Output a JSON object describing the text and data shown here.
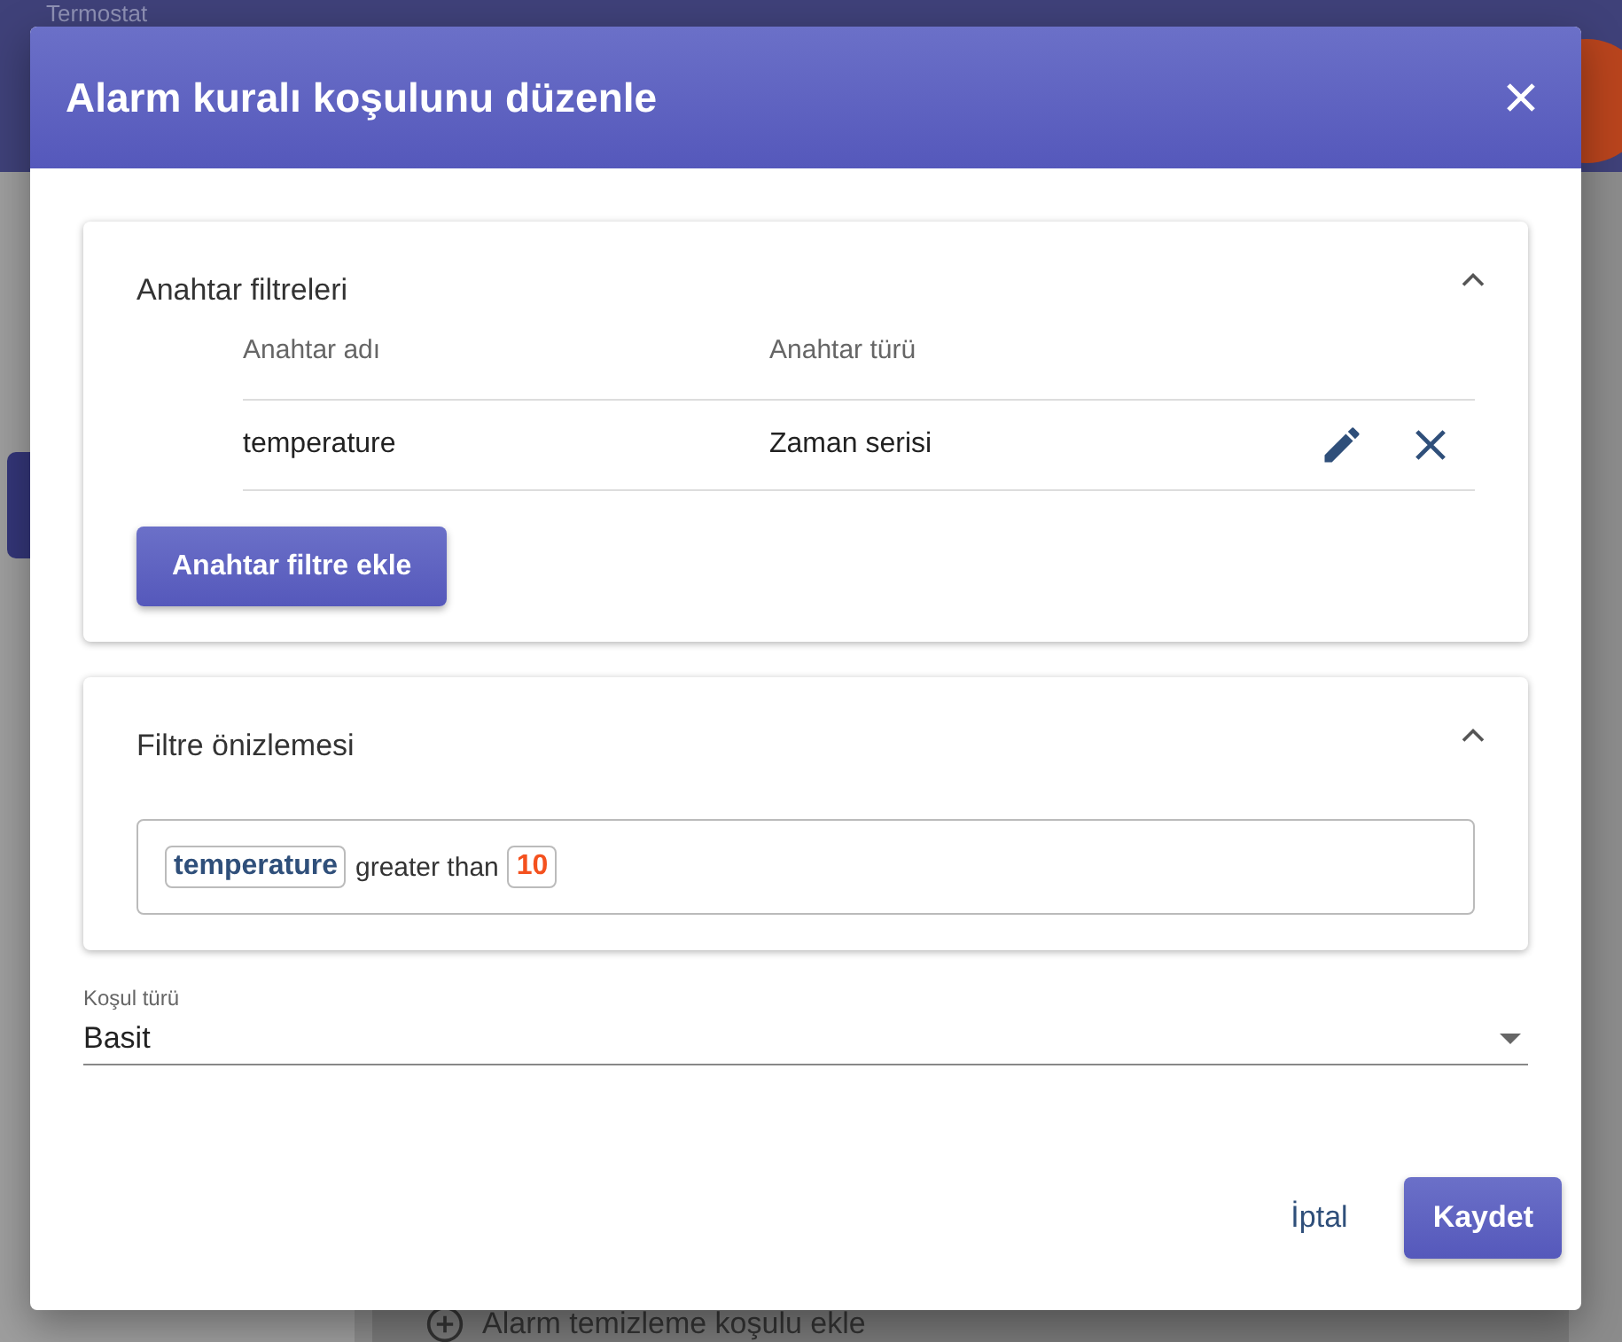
{
  "background": {
    "title": "Termostat",
    "bottom_button": "Alarm temizleme koşulu ekle"
  },
  "dialog": {
    "title": "Alarm kuralı koşulunu düzenle",
    "key_filters": {
      "title": "Anahtar filtreleri",
      "expanded": true,
      "columns": [
        "Anahtar adı",
        "Anahtar türü"
      ],
      "rows": [
        {
          "name": "temperature",
          "type": "Zaman serisi"
        }
      ],
      "add_button": "Anahtar filtre ekle"
    },
    "preview": {
      "title": "Filtre önizlemesi",
      "expanded": true,
      "tokens": [
        {
          "kind": "key",
          "text": "temperature"
        },
        {
          "kind": "op",
          "text": "greater than"
        },
        {
          "kind": "value",
          "text": "10"
        }
      ]
    },
    "condition_type": {
      "label": "Koşul türü",
      "value": "Basit"
    },
    "buttons": {
      "cancel": "İptal",
      "save": "Kaydet"
    }
  }
}
